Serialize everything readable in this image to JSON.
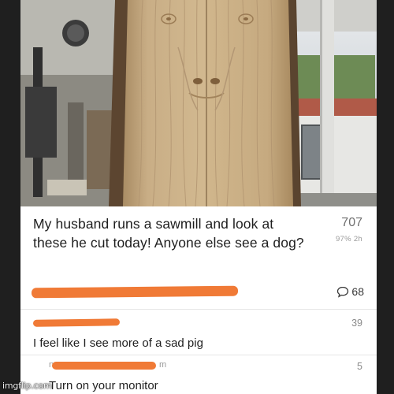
{
  "post": {
    "title": "My husband runs a sawmill and look at these he cut today! Anyone else see a dog?",
    "votes": "707",
    "meta": "97%  2h",
    "comment_count": "68"
  },
  "comments": [
    {
      "text": "I feel like I see more of a sad pig",
      "score": "39"
    },
    {
      "author_fragment_start": "n",
      "author_fragment_end": "m",
      "text": "Turn on your monitor",
      "score": "5"
    }
  ],
  "watermark": "imgflip.com",
  "colors": {
    "redaction": "#f07a36",
    "text": "#1e1e1e",
    "muted": "#8a8a8a",
    "wood": "#c9ad84"
  },
  "icons": {
    "comment": "speech-bubble-icon"
  }
}
